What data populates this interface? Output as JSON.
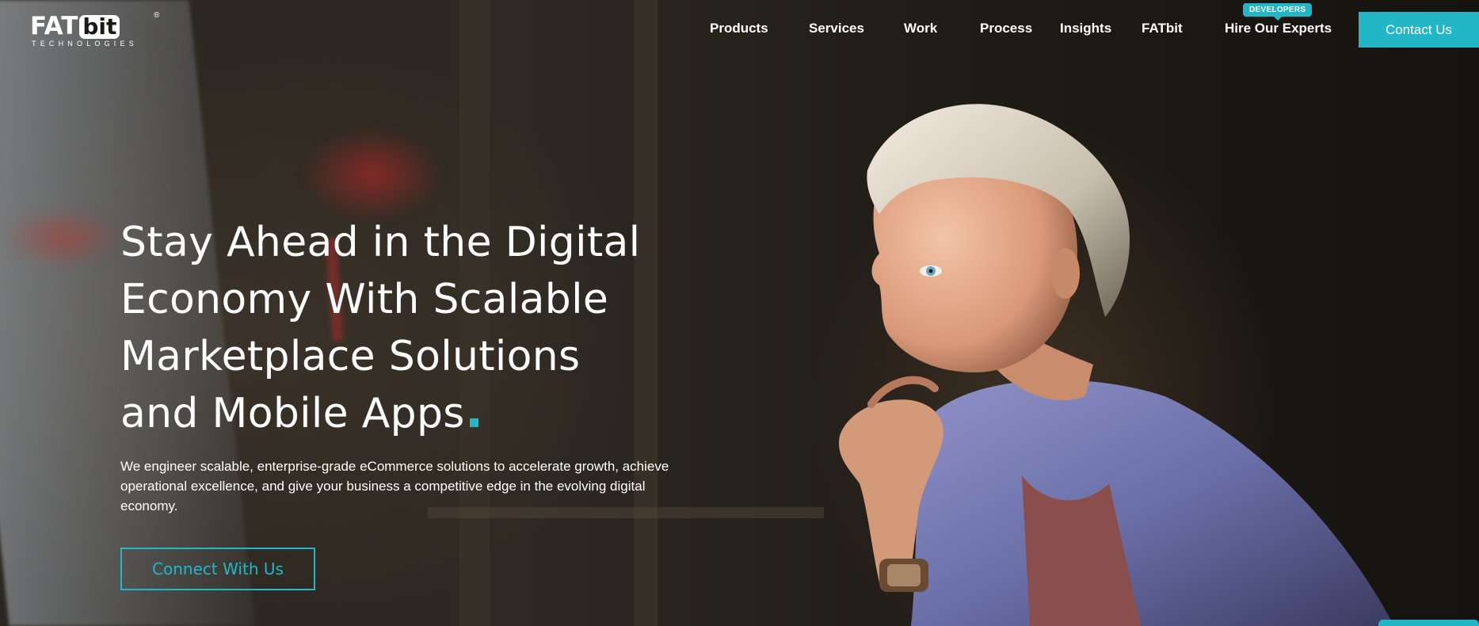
{
  "brand": {
    "logo_main": "FAT",
    "logo_bit": "bit",
    "logo_registered": "®",
    "logo_sub": "TECHNOLOGIES"
  },
  "nav": {
    "items": [
      {
        "label": "Products"
      },
      {
        "label": "Services"
      },
      {
        "label": "Work"
      },
      {
        "label": "Process"
      },
      {
        "label": "Insights"
      },
      {
        "label": "FATbit"
      },
      {
        "label": "Hire Our Experts",
        "badge": "DEVELOPERS"
      }
    ],
    "contact_label": "Contact Us"
  },
  "hero": {
    "title_lines": [
      "Stay Ahead in the Digital",
      "Economy With Scalable",
      "Marketplace Solutions",
      "and Mobile Apps"
    ],
    "description": "We engineer scalable, enterprise-grade eCommerce solutions to accelerate growth, achieve operational excellence, and give your business a competitive edge in the evolving digital economy.",
    "cta_label": "Connect With Us"
  },
  "colors": {
    "accent": "#21b7c9",
    "text": "#ffffff",
    "background": "#1c1915"
  }
}
